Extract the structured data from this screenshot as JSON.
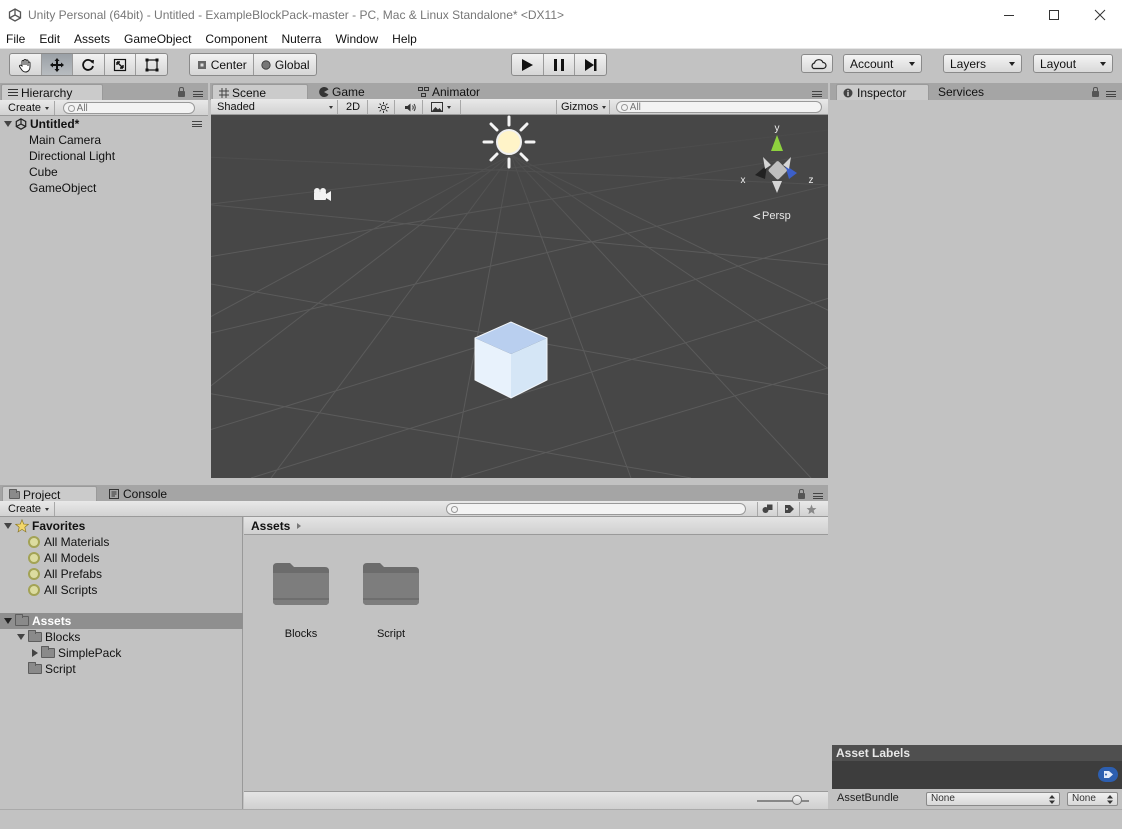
{
  "window": {
    "title": "Unity Personal (64bit) - Untitled - ExampleBlockPack-master - PC, Mac & Linux Standalone* <DX11>"
  },
  "menubar": {
    "items": [
      "File",
      "Edit",
      "Assets",
      "GameObject",
      "Component",
      "Nuterra",
      "Window",
      "Help"
    ]
  },
  "toolbar": {
    "pivot_label": "Center",
    "space_label": "Global",
    "account_label": "Account",
    "layers_label": "Layers",
    "layout_label": "Layout"
  },
  "hierarchy": {
    "tab_label": "Hierarchy",
    "create_label": "Create",
    "search_placeholder": "All",
    "scene_name": "Untitled*",
    "items": [
      "Main Camera",
      "Directional Light",
      "Cube",
      "GameObject"
    ]
  },
  "scene": {
    "tabs": [
      "Scene",
      "Game",
      "Animator"
    ],
    "shading_label": "Shaded",
    "mode_2d_label": "2D",
    "gizmos_label": "Gizmos",
    "search_placeholder": "All",
    "projection_label": "Persp",
    "axis_x": "x",
    "axis_y": "y",
    "axis_z": "z"
  },
  "inspector": {
    "tabs": [
      "Inspector",
      "Services"
    ],
    "asset_labels_title": "Asset Labels",
    "assetbundle_label": "AssetBundle",
    "bundle_name": "None",
    "bundle_variant": "None"
  },
  "project": {
    "tabs": [
      "Project",
      "Console"
    ],
    "create_label": "Create",
    "favorites_label": "Favorites",
    "favorites": [
      "All Materials",
      "All Models",
      "All Prefabs",
      "All Scripts"
    ],
    "assets_root": "Assets",
    "tree": {
      "blocks": "Blocks",
      "simplepack": "SimplePack",
      "script": "Script"
    },
    "breadcrumb": "Assets",
    "folders": [
      "Blocks",
      "Script"
    ]
  },
  "colors": {
    "scene_bg": "#474747",
    "selection_bg": "#8f8f8f",
    "asset_labels_bg": "#3d3d3d",
    "tag_badge": "#2d5fb0"
  }
}
